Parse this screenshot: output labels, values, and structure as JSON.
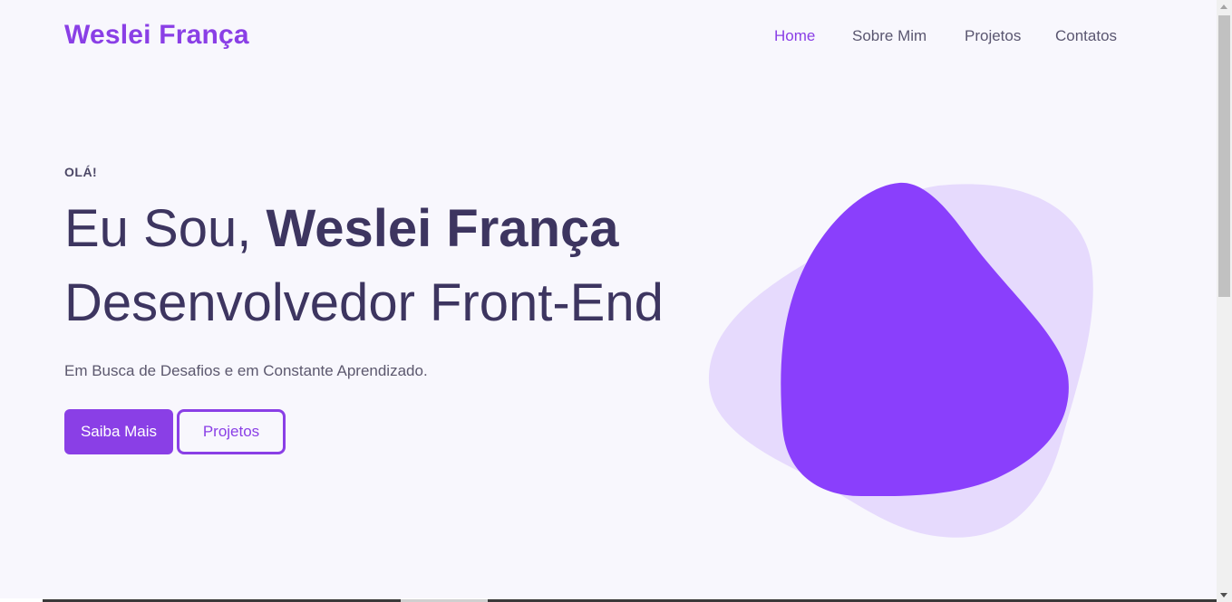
{
  "header": {
    "logo": "Weslei França",
    "nav": [
      {
        "label": "Home",
        "active": true
      },
      {
        "label": "Sobre Mim",
        "active": false
      },
      {
        "label": "Projetos",
        "active": false
      },
      {
        "label": "Contatos",
        "active": false
      }
    ]
  },
  "hero": {
    "greeting": "OLÁ!",
    "headline_prefix": "Eu Sou,",
    "headline_name": "Weslei França",
    "headline_role": "Desenvolvedor Front-End",
    "subtitle": "Em Busca de Desafios e em Constante Aprendizado.",
    "primary_button": "Saiba Mais",
    "secondary_button": "Projetos"
  },
  "colors": {
    "accent": "#8a3fe6",
    "blob_main": "#8a3ffc",
    "blob_back": "#e6dafd",
    "heading": "#3d3560",
    "background": "#f8f7fd"
  },
  "icons": {
    "illustration": "blob-shape-icon"
  }
}
